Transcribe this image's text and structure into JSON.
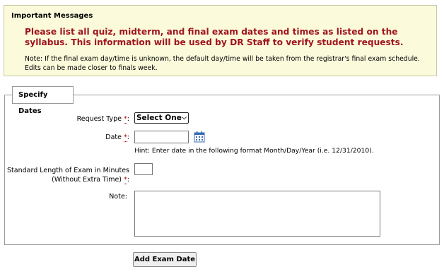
{
  "messages": {
    "title": "Important Messages",
    "important": "Please list all quiz, midterm, and final exam dates and times as listed on the syllabus. This information will be used by DR Staff to verify student requests.",
    "note": "Note: If the final exam day/time is unknown, the default day/time will be taken from the registrar's final exam schedule. Edits can be made closer to finals week."
  },
  "form": {
    "legend": "Specify Dates",
    "required_marker": "*",
    "request_type": {
      "label": "Request Type",
      "selected": "Select One"
    },
    "date": {
      "label": "Date",
      "value": "",
      "hint": "Hint: Enter date in the following format Month/Day/Year (i.e. 12/31/2010)."
    },
    "length": {
      "label_line1": "Standard Length of Exam in Minutes",
      "label_line2": "(Without Extra Time)",
      "value": ""
    },
    "note": {
      "label": "Note:",
      "value": ""
    },
    "submit_label": "Add Exam Date"
  },
  "icons": {
    "calendar": "calendar-icon",
    "dropdown": "chevron-down-icon"
  },
  "colors": {
    "message_bg": "#fbfbdc",
    "important_text": "#a0141e",
    "required": "#b00000"
  }
}
